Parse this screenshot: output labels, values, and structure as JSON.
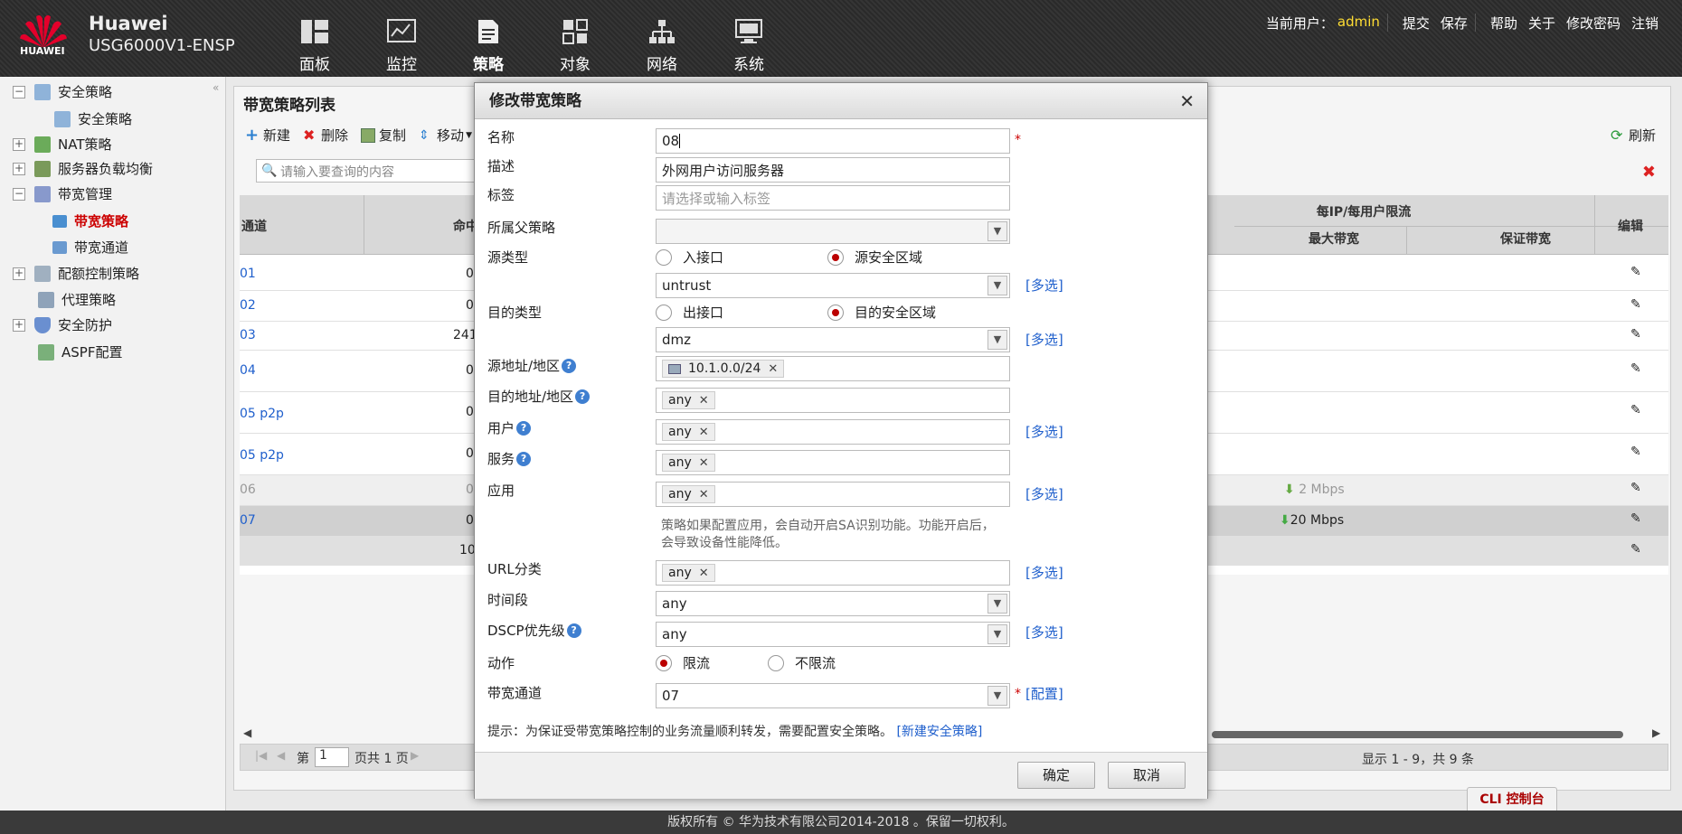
{
  "header": {
    "brand": "Huawei",
    "logo_text": "HUAWEI",
    "model": "USG6000V1-ENSP",
    "nav": [
      {
        "label": "面板",
        "icon": "dashboard-icon"
      },
      {
        "label": "监控",
        "icon": "monitor-icon"
      },
      {
        "label": "策略",
        "icon": "policy-icon"
      },
      {
        "label": "对象",
        "icon": "object-icon"
      },
      {
        "label": "网络",
        "icon": "network-icon"
      },
      {
        "label": "系统",
        "icon": "system-icon"
      }
    ],
    "current_user_label": "当前用户：",
    "user": "admin",
    "links": [
      "提交",
      "保存",
      "帮助",
      "关于",
      "修改密码",
      "注销"
    ]
  },
  "sidebar": {
    "items": [
      {
        "label": "安全策略",
        "icon": "security-policy-icon"
      },
      {
        "label": "安全策略",
        "icon": "security-policy-sub-icon"
      },
      {
        "label": "NAT策略",
        "icon": "nat-icon"
      },
      {
        "label": "服务器负载均衡",
        "icon": "load-balance-icon"
      },
      {
        "label": "带宽管理",
        "icon": "bandwidth-manage-icon"
      },
      {
        "label": "带宽策略",
        "icon": "bandwidth-policy-icon"
      },
      {
        "label": "带宽通道",
        "icon": "bandwidth-channel-icon"
      },
      {
        "label": "配额控制策略",
        "icon": "quota-icon"
      },
      {
        "label": "代理策略",
        "icon": "proxy-icon"
      },
      {
        "label": "安全防护",
        "icon": "shield-icon"
      },
      {
        "label": "ASPF配置",
        "icon": "aspf-icon"
      }
    ]
  },
  "panel": {
    "title": "带宽策略列表",
    "toolbar": {
      "new": "新建",
      "delete": "删除",
      "copy": "复制",
      "move": "移动",
      "refresh": "刷新"
    },
    "search_placeholder": "请输入要查询的内容",
    "columns": {
      "channel": "通道",
      "hits": "命中",
      "per_ip": "每IP/每用户限流",
      "max_bw": "最大带宽",
      "guaranteed_bw": "保证带宽",
      "edit": "编辑"
    },
    "rows": [
      {
        "name": "01",
        "hits": "0",
        "max": ""
      },
      {
        "name": "02",
        "hits": "0",
        "max": ""
      },
      {
        "name": "03",
        "hits": "241",
        "max": ""
      },
      {
        "name": "04",
        "hits": "0",
        "max": ""
      },
      {
        "name": "05 p2p",
        "hits": "0",
        "max": ""
      },
      {
        "name": "05 p2p",
        "hits": "0",
        "max": ""
      },
      {
        "name": "06",
        "hits": "0",
        "max": "2 Mbps"
      },
      {
        "name": "07",
        "hits": "0",
        "max": "20 Mbps"
      },
      {
        "name": "",
        "hits": "10",
        "max": ""
      }
    ],
    "pager": {
      "page_prefix": "第",
      "page": "1",
      "total": "页共 1 页",
      "summary": "显示 1 - 9，共 9 条"
    }
  },
  "dialog": {
    "title": "修改带宽策略",
    "fields": {
      "name_label": "名称",
      "name_value": "08",
      "desc_label": "描述",
      "desc_value": "外网用户访问服务器",
      "tag_label": "标签",
      "tag_placeholder": "请选择或输入标签",
      "parent_label": "所属父策略",
      "parent_value": "",
      "src_type_label": "源类型",
      "src_opt1": "入接口",
      "src_opt2": "源安全区域",
      "src_zone": "untrust",
      "dst_type_label": "目的类型",
      "dst_opt1": "出接口",
      "dst_opt2": "目的安全区域",
      "dst_zone": "dmz",
      "src_addr_label": "源地址/地区",
      "src_addr_tag": "10.1.0.0/24",
      "dst_addr_label": "目的地址/地区",
      "dst_addr_tag": "any",
      "user_label": "用户",
      "user_tag": "any",
      "service_label": "服务",
      "service_tag": "any",
      "app_label": "应用",
      "app_tag": "any",
      "app_note": "策略如果配置应用，会自动开启SA识别功能。功能开启后，会导致设备性能降低。",
      "url_label": "URL分类",
      "url_tag": "any",
      "time_label": "时间段",
      "time_value": "any",
      "dscp_label": "DSCP优先级",
      "dscp_value": "any",
      "action_label": "动作",
      "action_opt1": "限流",
      "action_opt2": "不限流",
      "channel_label": "带宽通道",
      "channel_value": "07"
    },
    "multi_select": "[多选]",
    "config_link": "[配置]",
    "required": "*",
    "help": "?",
    "hint_text": "提示：为保证受带宽策略控制的业务流量顺利转发，需要配置安全策略。",
    "hint_link": "[新建安全策略]",
    "ok": "确定",
    "cancel": "取消"
  },
  "footer": {
    "copyright": "版权所有 © 华为技术有限公司2014-2018 。保留一切权利。",
    "cli": "CLI 控制台"
  },
  "colors": {
    "accent": "#1f5fcc",
    "active": "#cc0000",
    "user": "#ffdd33"
  }
}
